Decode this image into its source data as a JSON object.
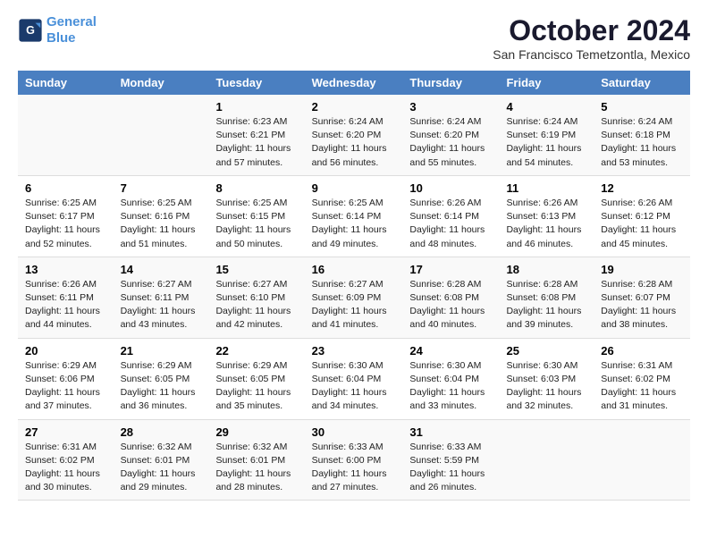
{
  "header": {
    "logo_line1": "General",
    "logo_line2": "Blue",
    "month_title": "October 2024",
    "location": "San Francisco Temetzontla, Mexico"
  },
  "weekdays": [
    "Sunday",
    "Monday",
    "Tuesday",
    "Wednesday",
    "Thursday",
    "Friday",
    "Saturday"
  ],
  "weeks": [
    [
      {
        "day": "",
        "info": ""
      },
      {
        "day": "",
        "info": ""
      },
      {
        "day": "1",
        "info": "Sunrise: 6:23 AM\nSunset: 6:21 PM\nDaylight: 11 hours and 57 minutes."
      },
      {
        "day": "2",
        "info": "Sunrise: 6:24 AM\nSunset: 6:20 PM\nDaylight: 11 hours and 56 minutes."
      },
      {
        "day": "3",
        "info": "Sunrise: 6:24 AM\nSunset: 6:20 PM\nDaylight: 11 hours and 55 minutes."
      },
      {
        "day": "4",
        "info": "Sunrise: 6:24 AM\nSunset: 6:19 PM\nDaylight: 11 hours and 54 minutes."
      },
      {
        "day": "5",
        "info": "Sunrise: 6:24 AM\nSunset: 6:18 PM\nDaylight: 11 hours and 53 minutes."
      }
    ],
    [
      {
        "day": "6",
        "info": "Sunrise: 6:25 AM\nSunset: 6:17 PM\nDaylight: 11 hours and 52 minutes."
      },
      {
        "day": "7",
        "info": "Sunrise: 6:25 AM\nSunset: 6:16 PM\nDaylight: 11 hours and 51 minutes."
      },
      {
        "day": "8",
        "info": "Sunrise: 6:25 AM\nSunset: 6:15 PM\nDaylight: 11 hours and 50 minutes."
      },
      {
        "day": "9",
        "info": "Sunrise: 6:25 AM\nSunset: 6:14 PM\nDaylight: 11 hours and 49 minutes."
      },
      {
        "day": "10",
        "info": "Sunrise: 6:26 AM\nSunset: 6:14 PM\nDaylight: 11 hours and 48 minutes."
      },
      {
        "day": "11",
        "info": "Sunrise: 6:26 AM\nSunset: 6:13 PM\nDaylight: 11 hours and 46 minutes."
      },
      {
        "day": "12",
        "info": "Sunrise: 6:26 AM\nSunset: 6:12 PM\nDaylight: 11 hours and 45 minutes."
      }
    ],
    [
      {
        "day": "13",
        "info": "Sunrise: 6:26 AM\nSunset: 6:11 PM\nDaylight: 11 hours and 44 minutes."
      },
      {
        "day": "14",
        "info": "Sunrise: 6:27 AM\nSunset: 6:11 PM\nDaylight: 11 hours and 43 minutes."
      },
      {
        "day": "15",
        "info": "Sunrise: 6:27 AM\nSunset: 6:10 PM\nDaylight: 11 hours and 42 minutes."
      },
      {
        "day": "16",
        "info": "Sunrise: 6:27 AM\nSunset: 6:09 PM\nDaylight: 11 hours and 41 minutes."
      },
      {
        "day": "17",
        "info": "Sunrise: 6:28 AM\nSunset: 6:08 PM\nDaylight: 11 hours and 40 minutes."
      },
      {
        "day": "18",
        "info": "Sunrise: 6:28 AM\nSunset: 6:08 PM\nDaylight: 11 hours and 39 minutes."
      },
      {
        "day": "19",
        "info": "Sunrise: 6:28 AM\nSunset: 6:07 PM\nDaylight: 11 hours and 38 minutes."
      }
    ],
    [
      {
        "day": "20",
        "info": "Sunrise: 6:29 AM\nSunset: 6:06 PM\nDaylight: 11 hours and 37 minutes."
      },
      {
        "day": "21",
        "info": "Sunrise: 6:29 AM\nSunset: 6:05 PM\nDaylight: 11 hours and 36 minutes."
      },
      {
        "day": "22",
        "info": "Sunrise: 6:29 AM\nSunset: 6:05 PM\nDaylight: 11 hours and 35 minutes."
      },
      {
        "day": "23",
        "info": "Sunrise: 6:30 AM\nSunset: 6:04 PM\nDaylight: 11 hours and 34 minutes."
      },
      {
        "day": "24",
        "info": "Sunrise: 6:30 AM\nSunset: 6:04 PM\nDaylight: 11 hours and 33 minutes."
      },
      {
        "day": "25",
        "info": "Sunrise: 6:30 AM\nSunset: 6:03 PM\nDaylight: 11 hours and 32 minutes."
      },
      {
        "day": "26",
        "info": "Sunrise: 6:31 AM\nSunset: 6:02 PM\nDaylight: 11 hours and 31 minutes."
      }
    ],
    [
      {
        "day": "27",
        "info": "Sunrise: 6:31 AM\nSunset: 6:02 PM\nDaylight: 11 hours and 30 minutes."
      },
      {
        "day": "28",
        "info": "Sunrise: 6:32 AM\nSunset: 6:01 PM\nDaylight: 11 hours and 29 minutes."
      },
      {
        "day": "29",
        "info": "Sunrise: 6:32 AM\nSunset: 6:01 PM\nDaylight: 11 hours and 28 minutes."
      },
      {
        "day": "30",
        "info": "Sunrise: 6:33 AM\nSunset: 6:00 PM\nDaylight: 11 hours and 27 minutes."
      },
      {
        "day": "31",
        "info": "Sunrise: 6:33 AM\nSunset: 5:59 PM\nDaylight: 11 hours and 26 minutes."
      },
      {
        "day": "",
        "info": ""
      },
      {
        "day": "",
        "info": ""
      }
    ]
  ]
}
